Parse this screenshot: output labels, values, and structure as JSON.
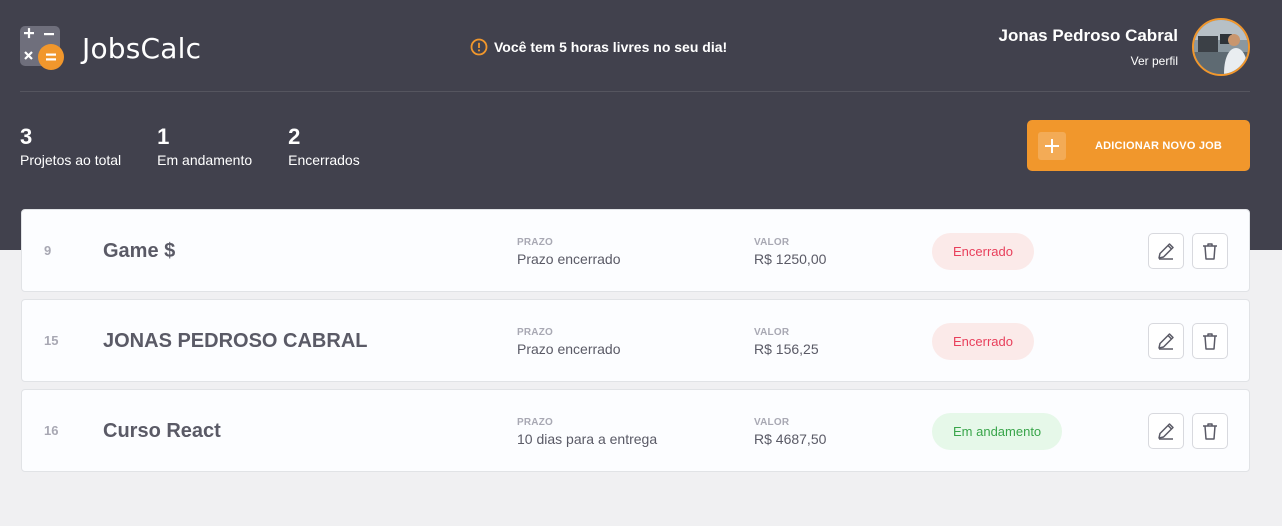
{
  "app": {
    "title": "JobsCalc"
  },
  "notice": {
    "text": "Você tem 5 horas livres no seu dia!"
  },
  "profile": {
    "name": "Jonas Pedroso Cabral",
    "link": "Ver perfil"
  },
  "summary": [
    {
      "value": "3",
      "label": "Projetos ao total"
    },
    {
      "value": "1",
      "label": "Em andamento"
    },
    {
      "value": "2",
      "label": "Encerrados"
    }
  ],
  "add_button": {
    "label": "ADICIONAR NOVO JOB"
  },
  "jobs": [
    {
      "id": "9",
      "name": "Game $",
      "deadline_label": "PRAZO",
      "deadline": "Prazo encerrado",
      "value_label": "VALOR",
      "value": "R$ 1250,00",
      "status": "Encerrado",
      "status_type": "closed"
    },
    {
      "id": "15",
      "name": "JONAS PEDROSO CABRAL",
      "deadline_label": "PRAZO",
      "deadline": "Prazo encerrado",
      "value_label": "VALOR",
      "value": "R$ 156,25",
      "status": "Encerrado",
      "status_type": "closed"
    },
    {
      "id": "16",
      "name": "Curso React",
      "deadline_label": "PRAZO",
      "deadline": "10 dias para a entrega",
      "value_label": "VALOR",
      "value": "R$ 4687,50",
      "status": "Em andamento",
      "status_type": "progress"
    }
  ],
  "icons": {
    "logo": "calculator-icon",
    "notice": "alert-circle-icon",
    "edit": "edit-pencil-icon",
    "delete": "trash-icon",
    "add": "plus-icon"
  },
  "colors": {
    "header_bg": "#41414d",
    "accent": "#f1972c",
    "closed_bg": "#fbeae9",
    "closed_text": "#e83f5b",
    "progress_bg": "#e6f8e9",
    "progress_text": "#39a54a"
  }
}
